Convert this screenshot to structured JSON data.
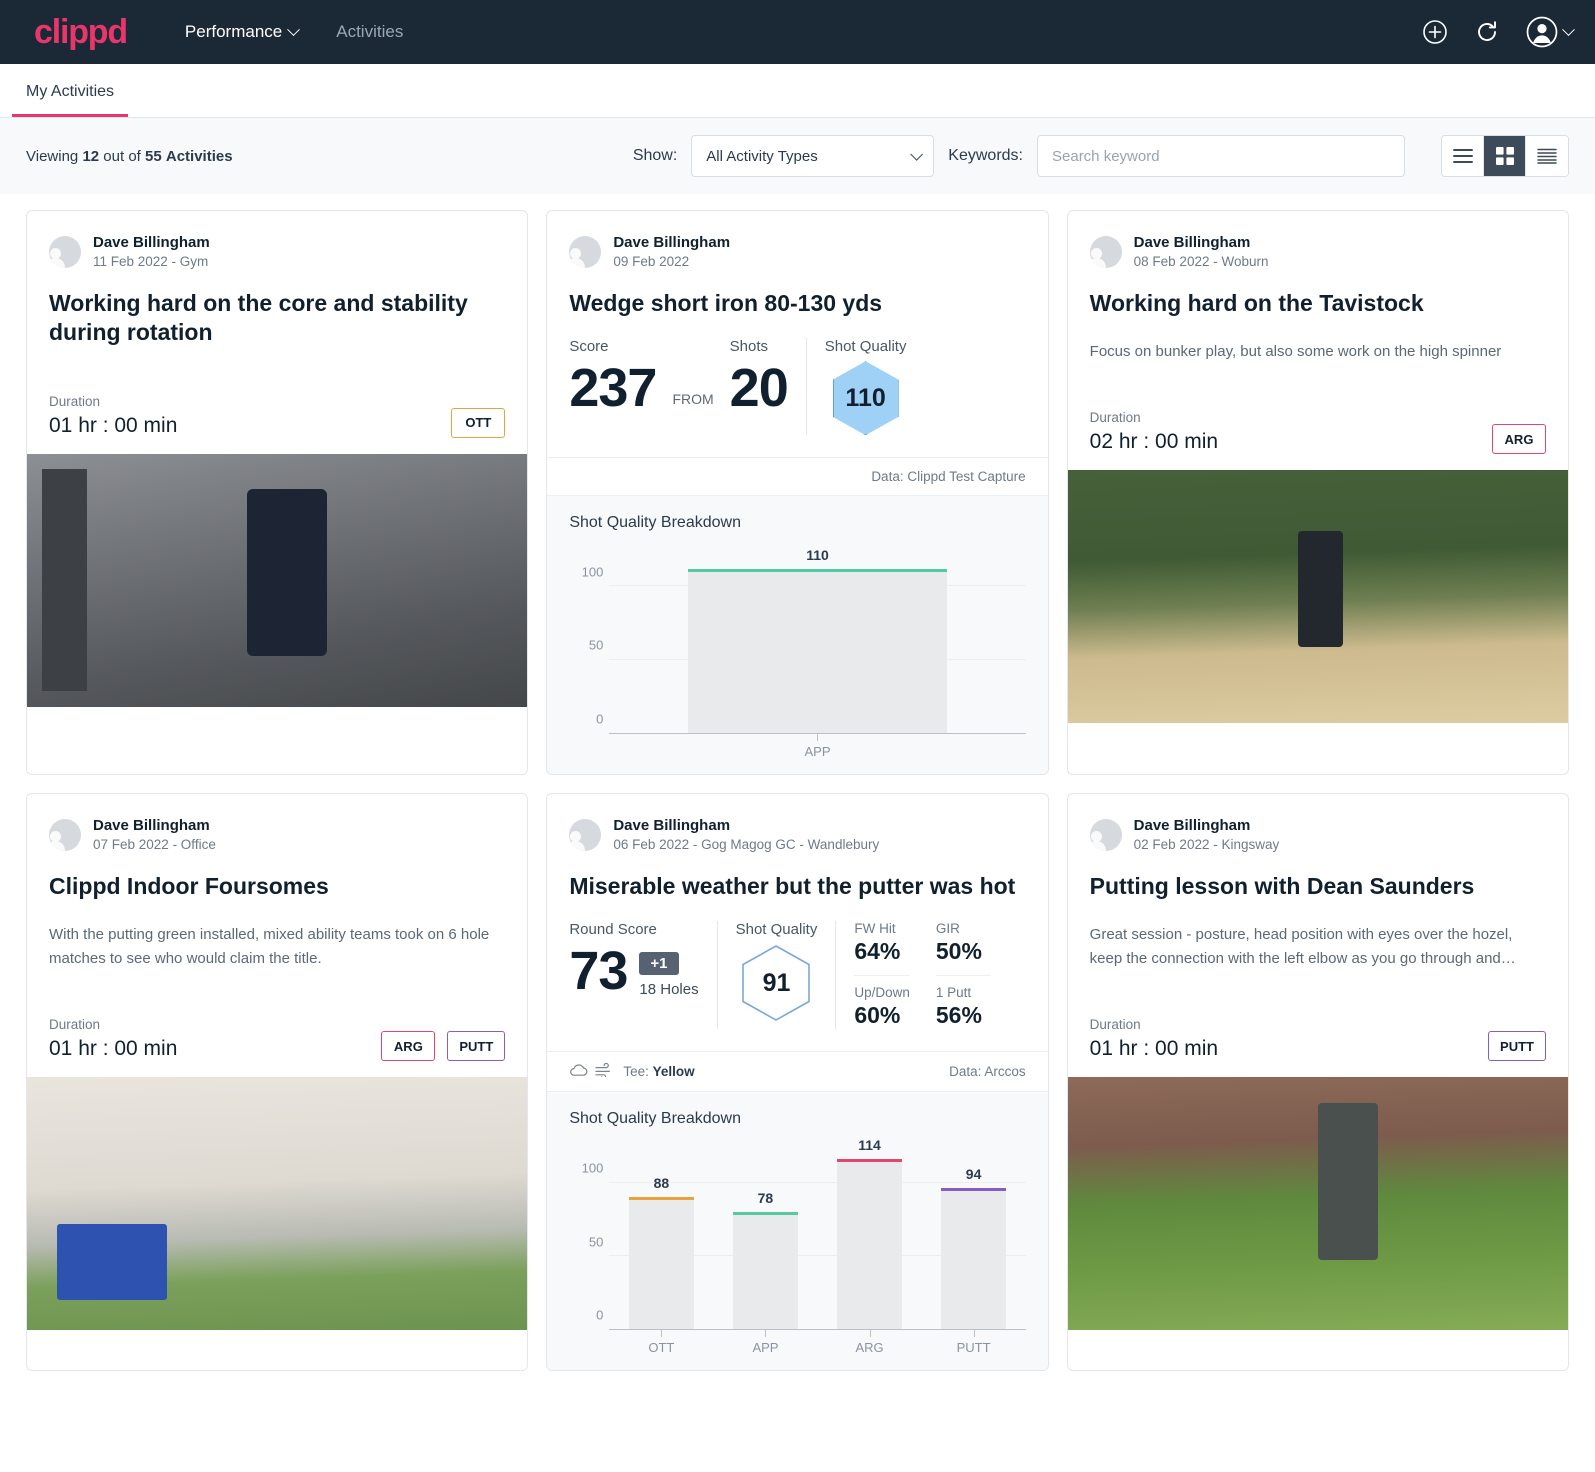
{
  "nav": {
    "brand": "clippd",
    "links": [
      {
        "label": "Performance",
        "has_chevron": true,
        "active": true
      },
      {
        "label": "Activities",
        "has_chevron": false,
        "active": false
      }
    ],
    "icons": [
      "plus-circle-icon",
      "refresh-icon",
      "account-icon"
    ]
  },
  "tabs": [
    {
      "label": "My Activities",
      "active": true
    }
  ],
  "filterbar": {
    "viewing_prefix": "Viewing",
    "viewing_count": "12",
    "viewing_middle": "out of",
    "viewing_total": "55",
    "viewing_suffix": "Activities",
    "show_label": "Show:",
    "activity_type_selected": "All Activity Types",
    "keywords_label": "Keywords:",
    "search_placeholder": "Search keyword",
    "search_value": "",
    "view_modes": [
      "list-view",
      "grid-view",
      "detail-view"
    ],
    "active_view": "grid-view"
  },
  "labels": {
    "duration": "Duration",
    "shot_quality_breakdown": "Shot Quality Breakdown",
    "score": "Score",
    "shots": "Shots",
    "shot_quality": "Shot Quality",
    "round_score": "Round Score",
    "from": "FROM",
    "holes": "18 Holes",
    "tee_prefix": "Tee:",
    "tee_value": "Yellow"
  },
  "colors": {
    "brand": "#e8366b",
    "navbar": "#1b2836",
    "tag_ott": "#e8a33d",
    "tag_arg": "#e0466e",
    "tag_putt": "#8b5cc0",
    "tag_app": "#57c9a0",
    "hex_fill": "#9fd0f5",
    "hex_stroke": "#5e9fd6"
  },
  "cards": [
    {
      "id": "core-stability",
      "author": "Dave Billingham",
      "meta": "11 Feb 2022 - Gym",
      "title": "Working hard on the core and stability during rotation",
      "description": "",
      "duration": "01 hr : 00 min",
      "tags": [
        {
          "label": "OTT",
          "color": "#e8a33d"
        }
      ],
      "photo": "gym-photo",
      "has_stats": false,
      "has_chart": false
    },
    {
      "id": "wedge-short-iron",
      "author": "Dave Billingham",
      "meta": "09 Feb 2022",
      "title": "Wedge short iron 80-130 yds",
      "score": "237",
      "shots": "20",
      "shot_quality": "110",
      "data_source": "Data: Clippd Test Capture",
      "has_stats": true,
      "has_chart": true,
      "chart_data": {
        "type": "bar",
        "title": "Shot Quality Breakdown",
        "categories": [
          "APP"
        ],
        "values": [
          110
        ],
        "cap_colors": [
          "#57c9a0"
        ],
        "ylim": [
          0,
          130
        ],
        "yticks": [
          0,
          50,
          100
        ],
        "xlabel": "",
        "ylabel": "",
        "grid": true,
        "legend": "none"
      }
    },
    {
      "id": "tavistock",
      "author": "Dave Billingham",
      "meta": "08 Feb 2022 - Woburn",
      "title": "Working hard on the Tavistock",
      "description": "Focus on bunker play, but also some work on the high spinner",
      "duration": "02 hr : 00 min",
      "tags": [
        {
          "label": "ARG",
          "color": "#e0466e"
        }
      ],
      "photo": "bunker-photo",
      "has_stats": false,
      "has_chart": false
    },
    {
      "id": "indoor-foursomes",
      "author": "Dave Billingham",
      "meta": "07 Feb 2022 - Office",
      "title": "Clippd Indoor Foursomes",
      "description": "With the putting green installed, mixed ability teams took on 6 hole matches to see who would claim the title.",
      "duration": "01 hr : 00 min",
      "tags": [
        {
          "label": "ARG",
          "color": "#e0466e"
        },
        {
          "label": "PUTT",
          "color": "#8b5cc0"
        }
      ],
      "photo": "indoor-photo",
      "has_stats": false,
      "has_chart": false
    },
    {
      "id": "miserable-weather",
      "author": "Dave Billingham",
      "meta": "06 Feb 2022 - Gog Magog GC - Wandlebury",
      "title": "Miserable weather but the putter was hot",
      "round_score": "73",
      "score_delta": "+1",
      "holes": "18 Holes",
      "shot_quality": "91",
      "percentages": [
        {
          "label": "FW Hit",
          "value": "64%"
        },
        {
          "label": "GIR",
          "value": "50%"
        },
        {
          "label": "Up/Down",
          "value": "60%"
        },
        {
          "label": "1 Putt",
          "value": "56%"
        }
      ],
      "weather_icons": [
        "cloud-icon",
        "wind-icon"
      ],
      "tee": "Yellow",
      "data_source": "Data: Arccos",
      "has_stats": true,
      "has_chart": true,
      "chart_data": {
        "type": "bar",
        "title": "Shot Quality Breakdown",
        "categories": [
          "OTT",
          "APP",
          "ARG",
          "PUTT"
        ],
        "values": [
          88,
          78,
          114,
          94
        ],
        "cap_colors": [
          "#e8a33d",
          "#57c9a0",
          "#e0466e",
          "#8b5cc0"
        ],
        "ylim": [
          0,
          130
        ],
        "yticks": [
          0,
          50,
          100
        ],
        "xlabel": "",
        "ylabel": "",
        "grid": true,
        "legend": "none"
      }
    },
    {
      "id": "putting-lesson",
      "author": "Dave Billingham",
      "meta": "02 Feb 2022 - Kingsway",
      "title": "Putting lesson with Dean Saunders",
      "description": "Great session - posture, head position with eyes over the hozel, keep the connection with the left elbow as you go through and…",
      "duration": "01 hr : 00 min",
      "tags": [
        {
          "label": "PUTT",
          "color": "#8b5cc0"
        }
      ],
      "photo": "green-photo",
      "has_stats": false,
      "has_chart": false
    }
  ]
}
